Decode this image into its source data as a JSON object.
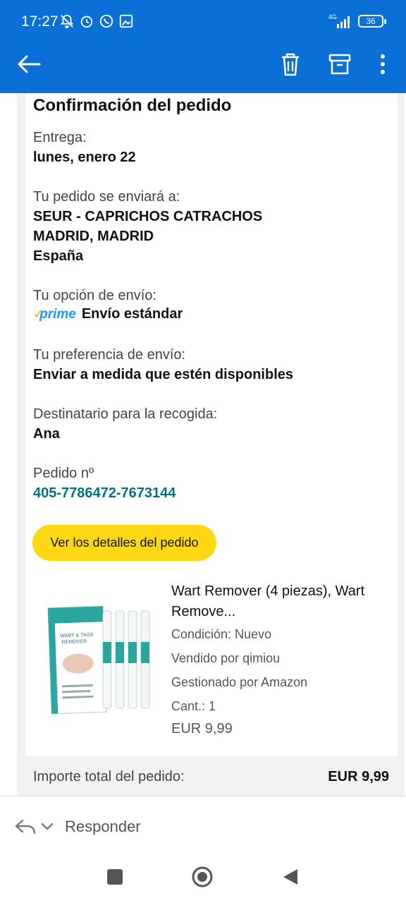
{
  "status": {
    "time": "17:27",
    "network": "4G",
    "battery": "36"
  },
  "toolbar": {
    "back": "back-arrow-icon",
    "delete": "trash-icon",
    "archive": "archive-icon",
    "more": "more-vert-icon"
  },
  "email": {
    "heading": "Confirmación del pedido",
    "delivery_label": "Entrega:",
    "delivery_value": "lunes, enero 22",
    "ship_to_label": "Tu pedido se enviará a:",
    "ship_to_line1": "SEUR - CAPRICHOS CATRACHOS",
    "ship_to_line2": "MADRID, MADRID",
    "ship_to_line3": "España",
    "option_label": "Tu opción de envío:",
    "prime_logo": "prime",
    "option_value": "Envío estándar",
    "pref_label": "Tu preferencia de envío:",
    "pref_value": "Enviar a medida que estén disponibles",
    "recipient_label": "Destinatario para la recogida:",
    "recipient_value": "Ana",
    "order_label": "Pedido nº",
    "order_number": "405-7786472-7673144",
    "details_button": "Ver los detalles del pedido",
    "product": {
      "title": "Wart Remover (4 piezas), Wart Remove...",
      "condition": "Condición: Nuevo",
      "seller": "Vendido por qimiou",
      "fulfilled": "Gestionado por Amazon",
      "qty": "Cant.: 1",
      "price": "EUR 9,99",
      "box_text_1": "WART & TAGS",
      "box_text_2": "REMOVER"
    },
    "total_label": "Importe total del pedido:",
    "total_value": "EUR 9,99"
  },
  "reply": {
    "label": "Responder"
  },
  "colors": {
    "appbar": "#0a6fd6",
    "button": "#ffd814",
    "link": "#007185"
  }
}
